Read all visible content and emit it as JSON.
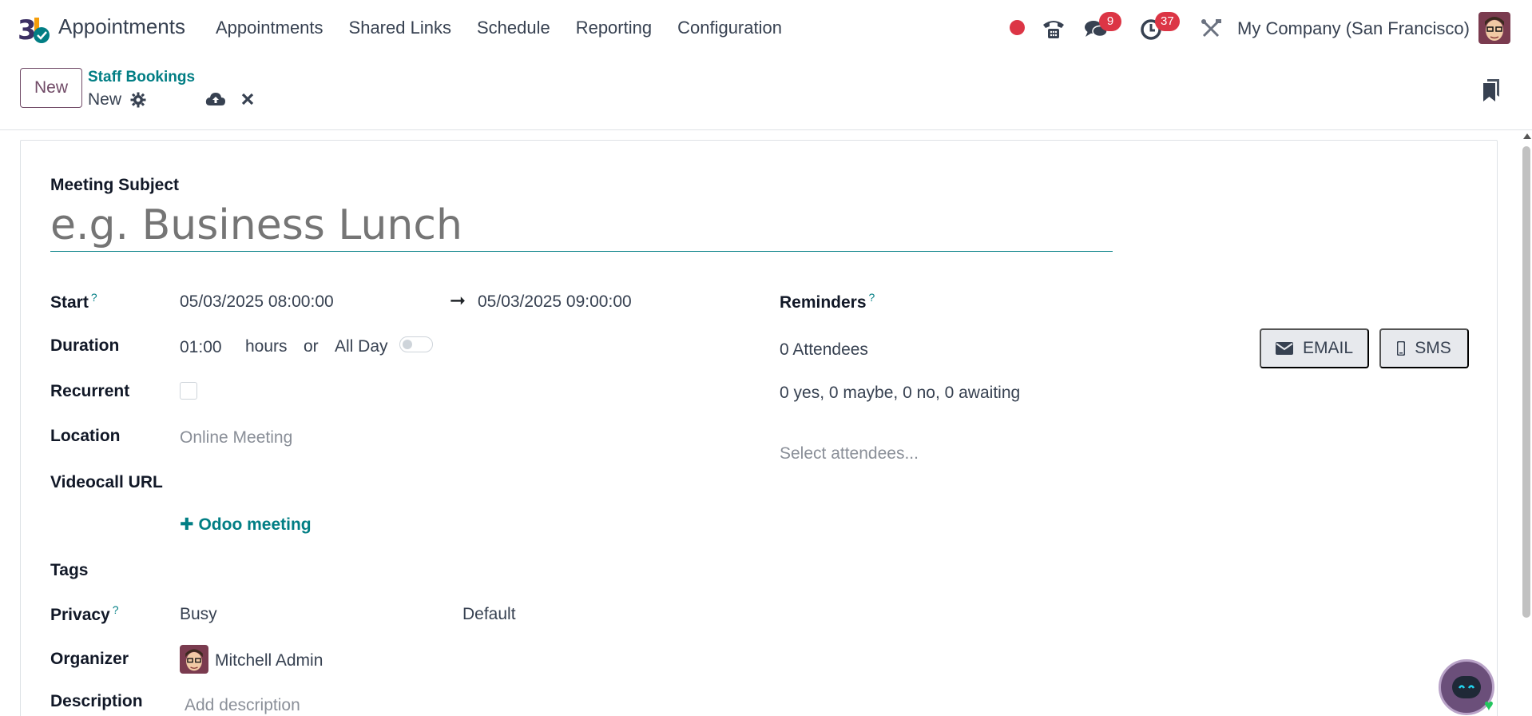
{
  "app": {
    "name": "Appointments",
    "menu": [
      "Appointments",
      "Shared Links",
      "Schedule",
      "Reporting",
      "Configuration"
    ],
    "company": "My Company (San Francisco)",
    "badges": {
      "messages": "9",
      "activities": "37"
    },
    "colors": {
      "accent": "#017e84",
      "brand": "#714b67",
      "badge": "#dc3545"
    }
  },
  "control_panel": {
    "new_label": "New",
    "breadcrumb_parent": "Staff Bookings",
    "breadcrumb_current": "New"
  },
  "form": {
    "subject_label": "Meeting Subject",
    "subject_placeholder": "e.g. Business Lunch",
    "start_label": "Start",
    "start_help": "?",
    "start_value": "05/03/2025 08:00:00",
    "stop_value": "05/03/2025 09:00:00",
    "duration_label": "Duration",
    "duration_value": "01:00",
    "hours_text": "hours",
    "or_text": "or",
    "all_day_text": "All Day",
    "all_day": false,
    "recurrent_label": "Recurrent",
    "recurrent": false,
    "location_label": "Location",
    "location_placeholder": "Online Meeting",
    "videocall_label": "Videocall URL",
    "odoo_meeting_label": "Odoo meeting",
    "tags_label": "Tags",
    "privacy_label": "Privacy",
    "privacy_help": "?",
    "show_as_value": "Busy",
    "privacy_value": "Default",
    "organizer_label": "Organizer",
    "organizer_value": "Mitchell Admin",
    "description_label": "Description",
    "description_placeholder": "Add description",
    "reminders_label": "Reminders",
    "reminders_help": "?",
    "attendees_count": "0 Attendees",
    "attendees_status": "0 yes, 0 maybe, 0 no, 0 awaiting",
    "attendees_placeholder": "Select attendees...",
    "email_button": "EMAIL",
    "sms_button": "SMS"
  }
}
